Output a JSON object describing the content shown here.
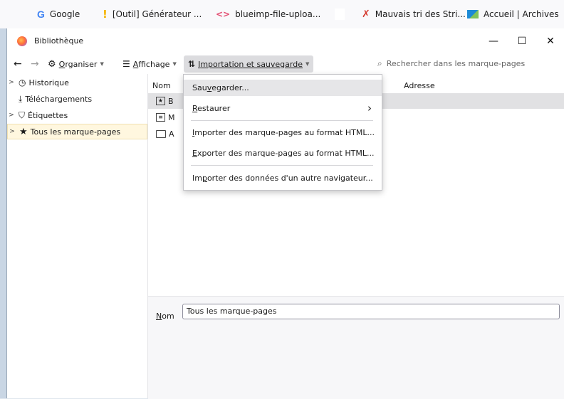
{
  "bookmarks_bar": {
    "items": [
      {
        "label": "Google",
        "icon": "google-icon"
      },
      {
        "label": "[Outil] Générateur ...",
        "icon": "exclamation-icon"
      },
      {
        "label": "blueimp-file-uploa...",
        "icon": "code-icon"
      },
      {
        "label": "Mauvais tri des Stri...",
        "icon": "person-run-icon"
      },
      {
        "label": "Accueil | Archives",
        "icon": "archives-icon"
      }
    ]
  },
  "window": {
    "title": "Bibliothèque",
    "controls": {
      "minimize": "—",
      "maximize": "☐",
      "close": "✕"
    }
  },
  "toolbar": {
    "back": "←",
    "forward": "→",
    "organise": {
      "label_u": "O",
      "label_rest": "rganiser"
    },
    "view": {
      "label_u": "A",
      "label_rest": "ffichage"
    },
    "import": {
      "label_u": "I",
      "label_rest": "mportation et sauvegarde"
    },
    "search_placeholder": "Rechercher dans les marque-pages"
  },
  "sidebar": {
    "items": [
      {
        "label": "Historique",
        "expandable": true
      },
      {
        "label": "Téléchargements",
        "expandable": false
      },
      {
        "label": "Étiquettes",
        "expandable": true
      },
      {
        "label": "Tous les marque-pages",
        "expandable": true,
        "selected": true
      }
    ]
  },
  "list": {
    "columns": {
      "name": "Nom",
      "address": "Adresse"
    },
    "rows": [
      {
        "letter": "B",
        "icon": "toolbar-folder-icon",
        "selected": true
      },
      {
        "letter": "M",
        "icon": "menu-folder-icon",
        "selected": false
      },
      {
        "letter": "A",
        "icon": "folder-icon",
        "selected": false
      }
    ]
  },
  "details": {
    "name_label_u": "N",
    "name_label_rest": "om",
    "name_value": "Tous les marque-pages"
  },
  "menu": {
    "items": [
      {
        "pre": "Sau",
        "u": "v",
        "post": "egarder...",
        "highlighted": true
      },
      {
        "pre": "",
        "u": "R",
        "post": "estaurer",
        "submenu": true
      },
      {
        "pre": "",
        "u": "I",
        "post": "mporter des marque-pages au format HTML..."
      },
      {
        "pre": "",
        "u": "E",
        "post": "xporter des marque-pages au format HTML..."
      },
      {
        "pre": "Im",
        "u": "p",
        "post": "orter des données d'un autre navigateur..."
      }
    ],
    "submenu_arrow": "›"
  }
}
